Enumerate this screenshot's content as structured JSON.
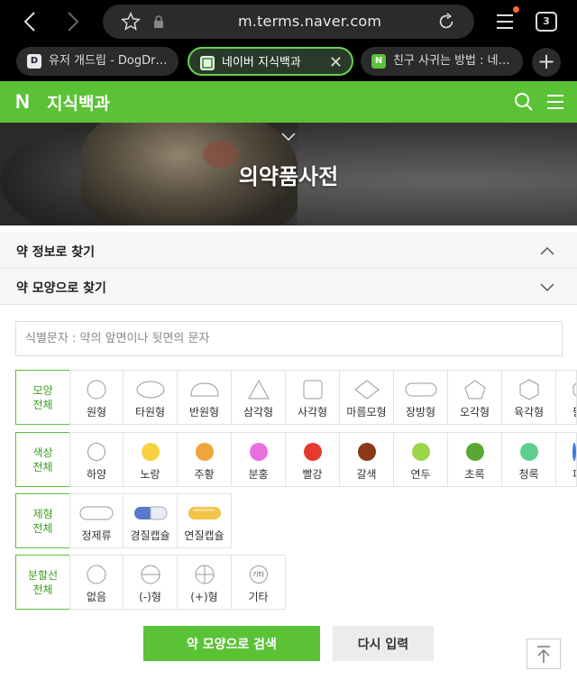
{
  "browser": {
    "url": "m.terms.naver.com",
    "tab_count": "3",
    "tabs": [
      {
        "favicon": "D",
        "title": "유저 개드립 - DogDri…"
      },
      {
        "favicon": "",
        "title": "네이버 지식백과",
        "active": true
      },
      {
        "favicon": "N",
        "title": "친구 사귀는 방법 : 네…"
      }
    ]
  },
  "header": {
    "logo": "N",
    "title": "지식백과"
  },
  "hero": {
    "title": "의약품사전"
  },
  "accordions": [
    {
      "label": "약 정보로 찾기",
      "state": "expanded"
    },
    {
      "label": "약 모양으로 찾기",
      "state": "collapsed"
    }
  ],
  "search": {
    "placeholder": "식별문자 : 약의 앞면이나 뒷면의 문자"
  },
  "shape": {
    "category": [
      "모양",
      "전체"
    ],
    "options": [
      {
        "label": "원형",
        "icon": "circle-shape-icon"
      },
      {
        "label": "타원형",
        "icon": "oval-shape-icon"
      },
      {
        "label": "반원형",
        "icon": "semicircle-shape-icon"
      },
      {
        "label": "삼각형",
        "icon": "triangle-shape-icon"
      },
      {
        "label": "사각형",
        "icon": "square-shape-icon"
      },
      {
        "label": "마름모형",
        "icon": "diamond-shape-icon"
      },
      {
        "label": "장방형",
        "icon": "rectangle-shape-icon"
      },
      {
        "label": "오각형",
        "icon": "pentagon-shape-icon"
      },
      {
        "label": "육각형",
        "icon": "hexagon-shape-icon"
      },
      {
        "label": "팔",
        "icon": "octagon-shape-icon"
      }
    ]
  },
  "color": {
    "category": [
      "색상",
      "전체"
    ],
    "options": [
      {
        "label": "하양",
        "hex": "#ffffff"
      },
      {
        "label": "노랑",
        "hex": "#f7d23e"
      },
      {
        "label": "주황",
        "hex": "#f0a43c"
      },
      {
        "label": "분홍",
        "hex": "#e86fe0"
      },
      {
        "label": "빨강",
        "hex": "#e53a2f"
      },
      {
        "label": "갈색",
        "hex": "#8a3a1a"
      },
      {
        "label": "연두",
        "hex": "#9ad648"
      },
      {
        "label": "초록",
        "hex": "#58a832"
      },
      {
        "label": "청록",
        "hex": "#5fcf8f"
      },
      {
        "label": "파",
        "hex": "#3a7ad8"
      }
    ]
  },
  "form": {
    "category": [
      "제형",
      "전체"
    ],
    "options": [
      {
        "label": "정제류",
        "icon": "tablet-icon"
      },
      {
        "label": "경질캡슐",
        "icon": "hard-capsule-icon"
      },
      {
        "label": "연질캡슐",
        "icon": "soft-capsule-icon"
      }
    ]
  },
  "score": {
    "category": [
      "분할선",
      "전체"
    ],
    "options": [
      {
        "label": "없음",
        "icon": "no-line-icon"
      },
      {
        "label": "(-)형",
        "icon": "minus-line-icon"
      },
      {
        "label": "(+)형",
        "icon": "plus-line-icon"
      },
      {
        "label": "기타",
        "icon": "other-line-icon",
        "glyph_text": "기타"
      }
    ]
  },
  "buttons": {
    "search": "약 모양으로 검색",
    "reset": "다시 입력"
  },
  "colors": {
    "brand": "#5bc236",
    "chrome": "#000000"
  }
}
